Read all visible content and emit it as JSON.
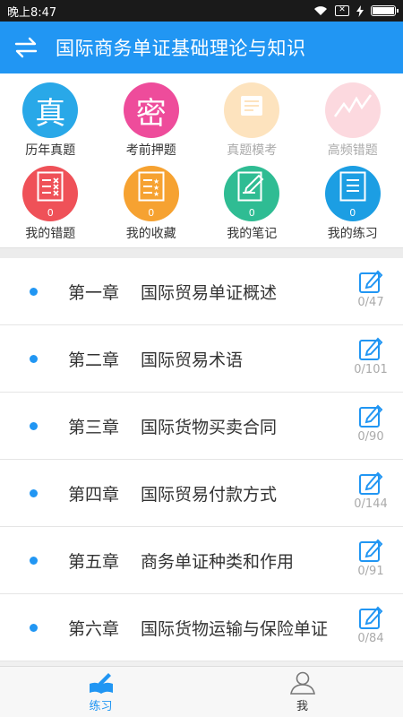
{
  "status": {
    "time": "晚上8:47"
  },
  "header": {
    "title": "国际商务单证基础理论与知识"
  },
  "grid": [
    {
      "label": "历年真题",
      "glyph": "真",
      "color": "#29a8e8",
      "dim": false
    },
    {
      "label": "考前押题",
      "glyph": "密",
      "color": "#ee4c9b",
      "dim": false
    },
    {
      "label": "真题模考",
      "color": "#fde3be",
      "dim": true
    },
    {
      "label": "高频错题",
      "color": "#fcd9df",
      "dim": true
    },
    {
      "label": "我的错题",
      "count": "0",
      "color": "#ef5158",
      "dim": false
    },
    {
      "label": "我的收藏",
      "count": "0",
      "color": "#f6a231",
      "dim": false
    },
    {
      "label": "我的笔记",
      "count": "0",
      "color": "#2fbc93",
      "dim": false
    },
    {
      "label": "我的练习",
      "count": "0",
      "color": "#1c9ee3",
      "dim": false
    }
  ],
  "chapters": [
    {
      "num": "第一章",
      "name": "国际贸易单证概述",
      "progress": "0/47"
    },
    {
      "num": "第二章",
      "name": "国际贸易术语",
      "progress": "0/101"
    },
    {
      "num": "第三章",
      "name": "国际货物买卖合同",
      "progress": "0/90"
    },
    {
      "num": "第四章",
      "name": "国际贸易付款方式",
      "progress": "0/144"
    },
    {
      "num": "第五章",
      "name": "商务单证种类和作用",
      "progress": "0/91"
    },
    {
      "num": "第六章",
      "name": "国际货物运输与保险单证",
      "progress": "0/84"
    }
  ],
  "nav": {
    "practice_label": "练习",
    "me_label": "我"
  },
  "colors": {
    "accent": "#2196f3"
  }
}
